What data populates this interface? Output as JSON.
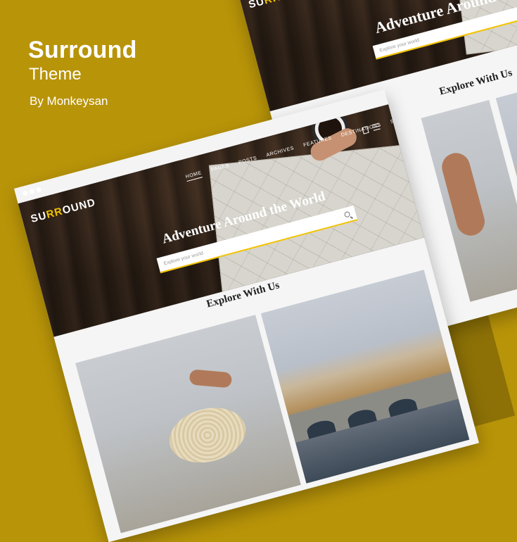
{
  "promo": {
    "title": "Surround",
    "subtitle": "Theme",
    "byline": "By Monkeysan"
  },
  "theme": {
    "logo_prefix": "SU",
    "logo_accent": "RR",
    "logo_suffix": "OUND",
    "brand_color": "#f2c200",
    "background_color": "#b89409"
  },
  "site": {
    "nav": [
      "HOME",
      "PAGES",
      "POSTS",
      "ARCHIVES",
      "FEATURES",
      "DESTINATIONS",
      "SHOP"
    ],
    "hero_title": "Adventure Around the World",
    "search_placeholder": "Explore your world",
    "section_title": "Explore With Us"
  }
}
